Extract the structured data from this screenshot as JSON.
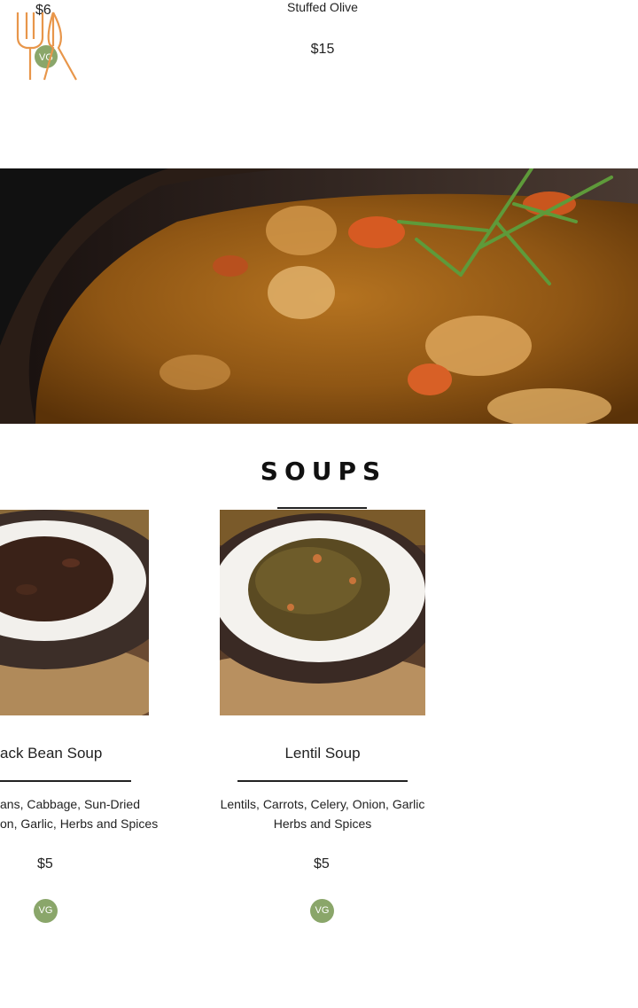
{
  "top_item": {
    "name": "Stuffed Olive",
    "price": "$15",
    "left_price_partial": "$6",
    "badge": "VG"
  },
  "section": {
    "title": "SOUPS"
  },
  "items": [
    {
      "name": "ack Bean Soup",
      "desc_line1": "ans, Cabbage, Sun-Dried",
      "desc_line2": "on, Garlic, Herbs and Spices",
      "price": "$5",
      "badge": "VG"
    },
    {
      "name": "Lentil Soup",
      "desc_line1": "Lentils, Carrots, Celery, Onion, Garlic",
      "desc_line2": "Herbs and Spices",
      "price": "$5",
      "badge": "VG"
    }
  ],
  "colors": {
    "accent": "#e8964a",
    "badge": "#8aa66a",
    "text": "#222222"
  },
  "icons": {
    "logo": "fork-knife-icon"
  }
}
